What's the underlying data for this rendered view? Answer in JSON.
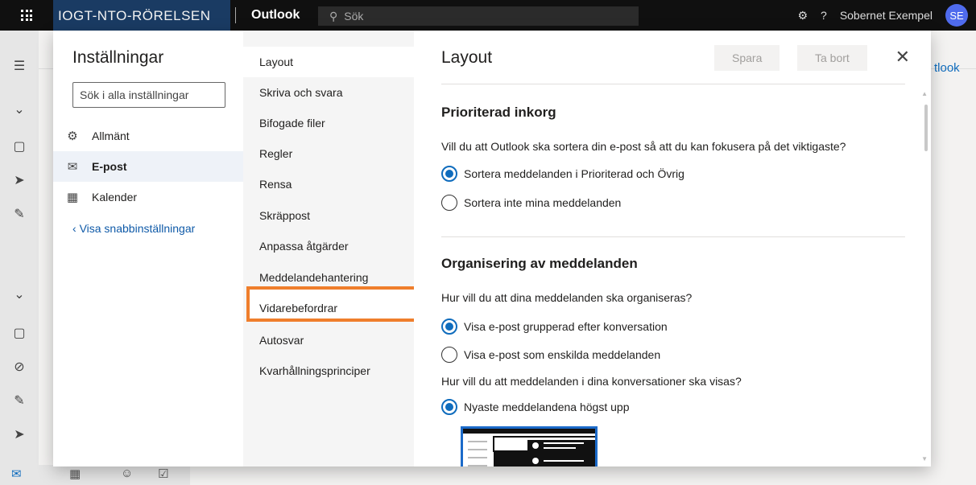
{
  "topbar": {
    "org_name": "IOGT-NTO-RÖRELSEN",
    "app_name": "Outlook",
    "search_placeholder": "Sök",
    "user_name": "Sobernet Exempel",
    "user_initials": "SE"
  },
  "background": {
    "outlook_fragment": "tlook"
  },
  "settings": {
    "title": "Inställningar",
    "search_placeholder": "Sök i alla inställningar",
    "nav": [
      {
        "label": "Allmänt",
        "icon": "gear-icon"
      },
      {
        "label": "E-post",
        "icon": "mail-icon",
        "active": true
      },
      {
        "label": "Kalender",
        "icon": "calendar-icon"
      }
    ],
    "quick_settings": "Visa snabbinställningar"
  },
  "subnav": {
    "items": [
      "Layout",
      "Skriva och svara",
      "Bifogade filer",
      "Regler",
      "Rensa",
      "Skräppost",
      "Anpassa åtgärder",
      "Meddelandehantering",
      "Vidarebefordrar",
      "Autosvar",
      "Kvarhållningsprinciper"
    ],
    "active_index": 0,
    "highlighted_index": 8,
    "highlight_color": "#ef7e2c"
  },
  "content": {
    "title": "Layout",
    "save_label": "Spara",
    "discard_label": "Ta bort",
    "focused_inbox": {
      "title": "Prioriterad inkorg",
      "question": "Vill du att Outlook ska sortera din e-post så att du kan fokusera på det viktigaste?",
      "options": [
        {
          "label": "Sortera meddelanden i Prioriterad och Övrig",
          "selected": true
        },
        {
          "label": "Sortera inte mina meddelanden",
          "selected": false
        }
      ]
    },
    "organization": {
      "title": "Organisering av meddelanden",
      "question": "Hur vill du att dina meddelanden ska organiseras?",
      "options": [
        {
          "label": "Visa e-post grupperad efter konversation",
          "selected": true
        },
        {
          "label": "Visa e-post som enskilda meddelanden",
          "selected": false
        }
      ],
      "question2": "Hur vill du att meddelanden i dina konversationer ska visas?",
      "options2": [
        {
          "label": "Nyaste meddelandena högst upp",
          "selected": true
        }
      ]
    }
  },
  "accent_color": "#0f6cbd"
}
